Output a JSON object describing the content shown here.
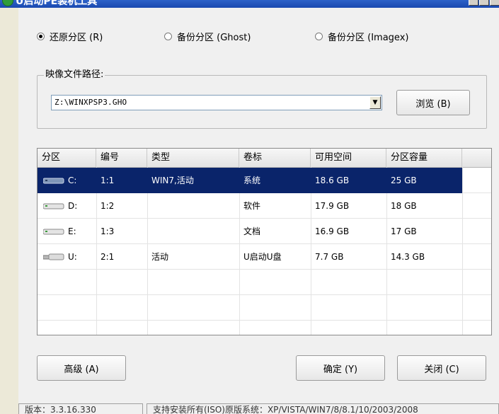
{
  "window": {
    "title": "U启动PE装机工具"
  },
  "modes": [
    {
      "label": "还原分区 (R)",
      "selected": true
    },
    {
      "label": "备份分区 (Ghost)",
      "selected": false
    },
    {
      "label": "备份分区 (Imagex)",
      "selected": false
    }
  ],
  "image_path": {
    "group_label": "映像文件路径:",
    "value": "Z:\\WINXPSP3.GHO",
    "browse_label": "浏览 (B)"
  },
  "partitions": {
    "columns": [
      "分区",
      "编号",
      "类型",
      "卷标",
      "可用空间",
      "分区容量"
    ],
    "rows": [
      {
        "drive": "C:",
        "icon": "hard-drive-icon",
        "number": "1:1",
        "type": "WIN7,活动",
        "label": "系统",
        "free": "18.6 GB",
        "capacity": "25 GB",
        "selected": true
      },
      {
        "drive": "D:",
        "icon": "hard-drive-icon",
        "number": "1:2",
        "type": "",
        "label": "软件",
        "free": "17.9 GB",
        "capacity": "18 GB",
        "selected": false
      },
      {
        "drive": "E:",
        "icon": "hard-drive-icon",
        "number": "1:3",
        "type": "",
        "label": "文档",
        "free": "16.9 GB",
        "capacity": "17 GB",
        "selected": false
      },
      {
        "drive": "U:",
        "icon": "usb-drive-icon",
        "number": "2:1",
        "type": "活动",
        "label": "U启动U盘",
        "free": "7.7 GB",
        "capacity": "14.3 GB",
        "selected": false
      }
    ]
  },
  "buttons": {
    "advanced": "高级 (A)",
    "ok": "确定 (Y)",
    "close": "关闭 (C)"
  },
  "status": {
    "version": "版本：3.3.16.330",
    "support": "支持安装所有(ISO)原版系统：XP/VISTA/WIN7/8/8.1/10/2003/2008"
  },
  "colors": {
    "title_bar": "#1f4fb8",
    "selection": "#0a246a",
    "window_bg": "#f0f0f0"
  }
}
